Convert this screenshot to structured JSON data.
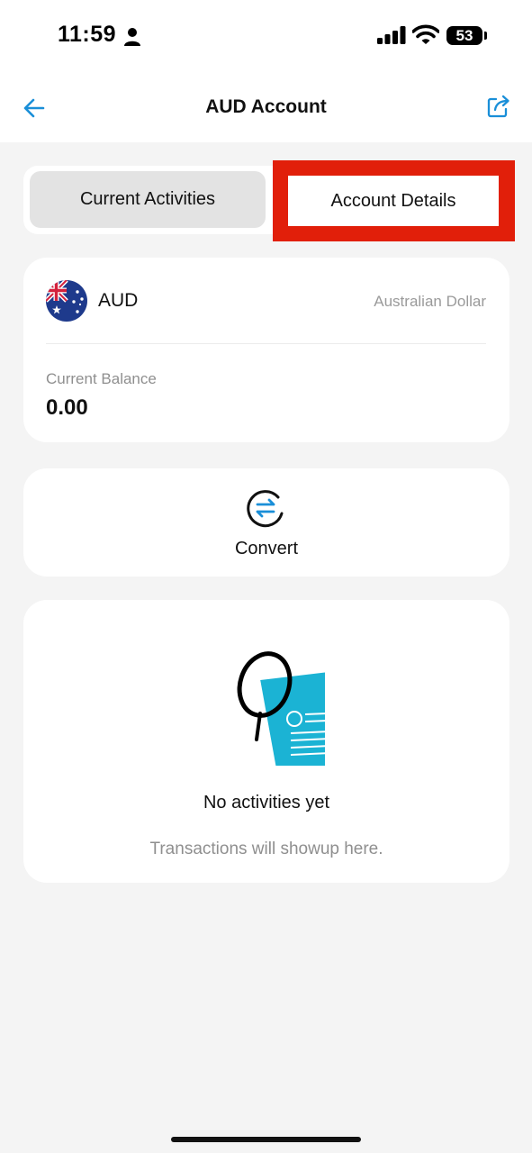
{
  "status_bar": {
    "time": "11:59",
    "battery": "53",
    "icons": [
      "person-icon",
      "signal-icon",
      "wifi-icon",
      "battery-icon"
    ]
  },
  "nav": {
    "title": "AUD Account",
    "back_icon": "back-arrow-icon",
    "share_icon": "share-icon",
    "accent_color": "#1a8fd8"
  },
  "tabs": {
    "current": "Current Activities",
    "details": "Account Details",
    "highlight_color": "#e11f0a"
  },
  "account": {
    "flag_icon": "australia-flag-icon",
    "code": "AUD",
    "name": "Australian Dollar",
    "balance_label": "Current Balance",
    "balance": "0.00"
  },
  "convert": {
    "icon": "convert-icon",
    "label": "Convert"
  },
  "empty_state": {
    "illustration": "magnifier-document-illustration",
    "title": "No activities yet",
    "subtitle": "Transactions will showup here.",
    "document_color": "#1bb3d4"
  }
}
